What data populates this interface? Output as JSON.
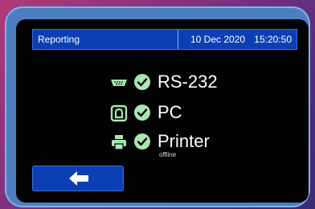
{
  "status_bar": {
    "title": "Reporting",
    "date": "10 Dec 2020",
    "time": "15:20:50"
  },
  "devices": [
    {
      "icon": "serial-port-icon",
      "status_icon": "check-circle-icon",
      "label": "RS-232",
      "sublabel": ""
    },
    {
      "icon": "pc-icon",
      "status_icon": "check-circle-icon",
      "label": "PC",
      "sublabel": ""
    },
    {
      "icon": "printer-icon",
      "status_icon": "check-circle-icon",
      "label": "Printer",
      "sublabel": "offline"
    }
  ],
  "back_button": {
    "icon": "arrow-left-icon"
  },
  "colors": {
    "bar_blue": "#0b3fb3",
    "device_frame": "#4c7fbf",
    "icon_green": "#a9e6b0",
    "screen_black": "#030303"
  }
}
